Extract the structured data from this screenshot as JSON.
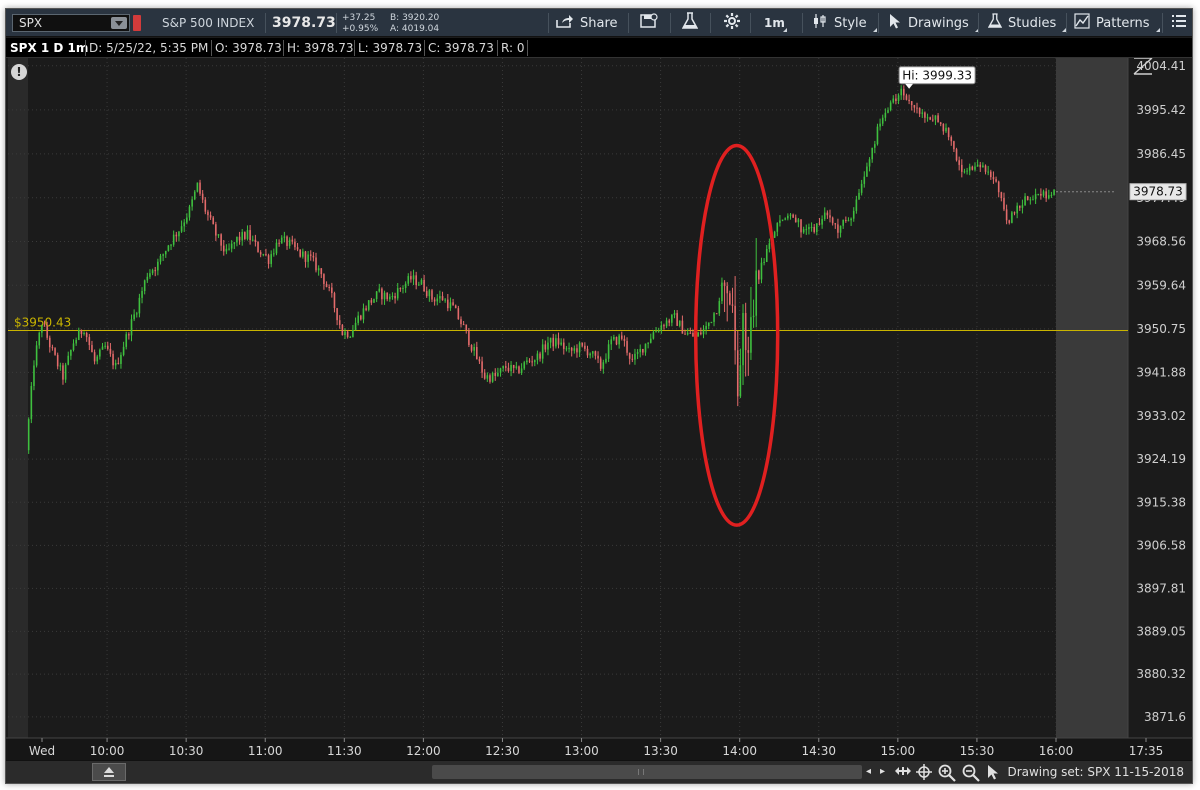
{
  "toolbar": {
    "symbol": "SPX",
    "index_name": "S&P 500 INDEX",
    "last_price": "3978.73",
    "net_change": "+37.25",
    "pct_change": "+0.95%",
    "bid": "B: 3920.20",
    "ask": "A: 4019.04",
    "share_label": "Share",
    "interval_label": "1m",
    "style_label": "Style",
    "drawings_label": "Drawings",
    "studies_label": "Studies",
    "patterns_label": "Patterns",
    "positive_color": "#cfd6dd"
  },
  "info_bar": {
    "title": "SPX 1 D 1m",
    "date": "D: 5/25/22, 5:35 PM",
    "open": "O: 3978.73",
    "high": "H: 3978.73",
    "low": "L: 3978.73",
    "close": "C: 3978.73",
    "range": "R: 0"
  },
  "alert_icon": "!",
  "bottom_bar": {
    "drawing_set": "Drawing set: SPX 11-15-2018",
    "icons": [
      "home-icon",
      "pan-icon",
      "crosshair-icon",
      "zoom-in-icon",
      "zoom-out-icon",
      "pointer-icon"
    ]
  },
  "chart_data": {
    "type": "candlestick",
    "symbol": "SPX",
    "interval": "1m",
    "ylim": [
      3867.3,
      4006.0
    ],
    "y_ticks": [
      "4004.41",
      "3995.42",
      "3986.45",
      "3977.49",
      "3968.56",
      "3959.64",
      "3950.75",
      "3941.88",
      "3933.02",
      "3924.19",
      "3915.38",
      "3906.58",
      "3897.81",
      "3889.05",
      "3880.32",
      "3871.6"
    ],
    "x_ticks": [
      {
        "label": "Wed",
        "t": "09:30"
      },
      {
        "label": "10:00",
        "t": "10:00"
      },
      {
        "label": "10:30",
        "t": "10:30"
      },
      {
        "label": "11:00",
        "t": "11:00"
      },
      {
        "label": "11:30",
        "t": "11:30"
      },
      {
        "label": "12:00",
        "t": "12:00"
      },
      {
        "label": "12:30",
        "t": "12:30"
      },
      {
        "label": "13:00",
        "t": "13:00"
      },
      {
        "label": "13:30",
        "t": "13:30"
      },
      {
        "label": "14:00",
        "t": "14:00"
      },
      {
        "label": "14:30",
        "t": "14:30"
      },
      {
        "label": "15:00",
        "t": "15:00"
      },
      {
        "label": "15:30",
        "t": "15:30"
      },
      {
        "label": "16:00",
        "t": "16:00"
      },
      {
        "label": "17:35",
        "t": "17:35"
      }
    ],
    "session_start": "09:30",
    "session_end": "16:00",
    "price_path": [
      [
        "09:30",
        3926
      ],
      [
        "09:33",
        3944
      ],
      [
        "09:36",
        3952
      ],
      [
        "09:40",
        3946
      ],
      [
        "09:44",
        3941
      ],
      [
        "09:48",
        3948
      ],
      [
        "09:52",
        3951
      ],
      [
        "09:56",
        3944
      ],
      [
        "10:00",
        3947
      ],
      [
        "10:04",
        3943
      ],
      [
        "10:08",
        3949
      ],
      [
        "10:12",
        3955
      ],
      [
        "10:16",
        3962
      ],
      [
        "10:20",
        3964
      ],
      [
        "10:24",
        3968
      ],
      [
        "10:28",
        3971
      ],
      [
        "10:32",
        3975
      ],
      [
        "10:35",
        3980
      ],
      [
        "10:38",
        3975
      ],
      [
        "10:42",
        3970
      ],
      [
        "10:46",
        3966
      ],
      [
        "10:50",
        3969
      ],
      [
        "10:54",
        3970
      ],
      [
        "10:58",
        3967
      ],
      [
        "11:02",
        3965
      ],
      [
        "11:06",
        3969
      ],
      [
        "11:10",
        3968
      ],
      [
        "11:14",
        3966
      ],
      [
        "11:18",
        3965
      ],
      [
        "11:22",
        3962
      ],
      [
        "11:26",
        3957
      ],
      [
        "11:30",
        3950
      ],
      [
        "11:33",
        3950
      ],
      [
        "11:36",
        3953
      ],
      [
        "11:40",
        3956
      ],
      [
        "11:44",
        3958
      ],
      [
        "11:48",
        3957
      ],
      [
        "11:52",
        3959
      ],
      [
        "11:56",
        3961
      ],
      [
        "12:00",
        3960
      ],
      [
        "12:04",
        3957
      ],
      [
        "12:08",
        3957
      ],
      [
        "12:12",
        3955
      ],
      [
        "12:16",
        3951
      ],
      [
        "12:20",
        3946
      ],
      [
        "12:24",
        3941
      ],
      [
        "12:28",
        3941
      ],
      [
        "12:32",
        3943
      ],
      [
        "12:36",
        3942
      ],
      [
        "12:40",
        3944
      ],
      [
        "12:44",
        3945
      ],
      [
        "12:48",
        3948
      ],
      [
        "12:52",
        3948
      ],
      [
        "12:56",
        3946
      ],
      [
        "13:00",
        3947
      ],
      [
        "13:04",
        3946
      ],
      [
        "13:08",
        3943
      ],
      [
        "13:12",
        3948
      ],
      [
        "13:16",
        3949
      ],
      [
        "13:20",
        3944
      ],
      [
        "13:24",
        3947
      ],
      [
        "13:28",
        3950
      ],
      [
        "13:32",
        3952
      ],
      [
        "13:36",
        3953
      ],
      [
        "13:40",
        3950
      ],
      [
        "13:44",
        3949
      ],
      [
        "13:48",
        3951
      ],
      [
        "13:52",
        3955
      ],
      [
        "13:55",
        3962
      ],
      [
        "13:57",
        3958
      ],
      [
        "13:59",
        3945
      ],
      [
        "14:00",
        3938
      ],
      [
        "14:02",
        3950
      ],
      [
        "14:04",
        3945
      ],
      [
        "14:06",
        3958
      ],
      [
        "14:10",
        3965
      ],
      [
        "14:14",
        3971
      ],
      [
        "14:18",
        3974
      ],
      [
        "14:22",
        3973
      ],
      [
        "14:26",
        3970
      ],
      [
        "14:30",
        3972
      ],
      [
        "14:34",
        3974
      ],
      [
        "14:38",
        3971
      ],
      [
        "14:42",
        3973
      ],
      [
        "14:46",
        3978
      ],
      [
        "14:50",
        3986
      ],
      [
        "14:54",
        3993
      ],
      [
        "14:58",
        3996
      ],
      [
        "15:02",
        3999
      ],
      [
        "15:06",
        3997
      ],
      [
        "15:10",
        3994
      ],
      [
        "15:14",
        3994
      ],
      [
        "15:18",
        3992
      ],
      [
        "15:22",
        3987
      ],
      [
        "15:26",
        3982
      ],
      [
        "15:30",
        3984
      ],
      [
        "15:34",
        3983
      ],
      [
        "15:38",
        3981
      ],
      [
        "15:42",
        3972
      ],
      [
        "15:46",
        3975
      ],
      [
        "15:50",
        3978
      ],
      [
        "15:54",
        3978
      ],
      [
        "16:00",
        3978.73
      ]
    ],
    "high_of_day": {
      "label": "Hi: 3999.33",
      "value": 3999.33,
      "t": "15:02"
    },
    "horizontal_line": {
      "label": "$3950.43",
      "value": 3950.43,
      "color": "#c9b400"
    },
    "last_price_label": "3978.73",
    "annotation": {
      "type": "ellipse",
      "color": "#e02020",
      "t": "14:00",
      "from": 3925,
      "to": 3980
    },
    "up_color": "#3fc03f",
    "down_color": "#e36b6b",
    "grid": true
  }
}
